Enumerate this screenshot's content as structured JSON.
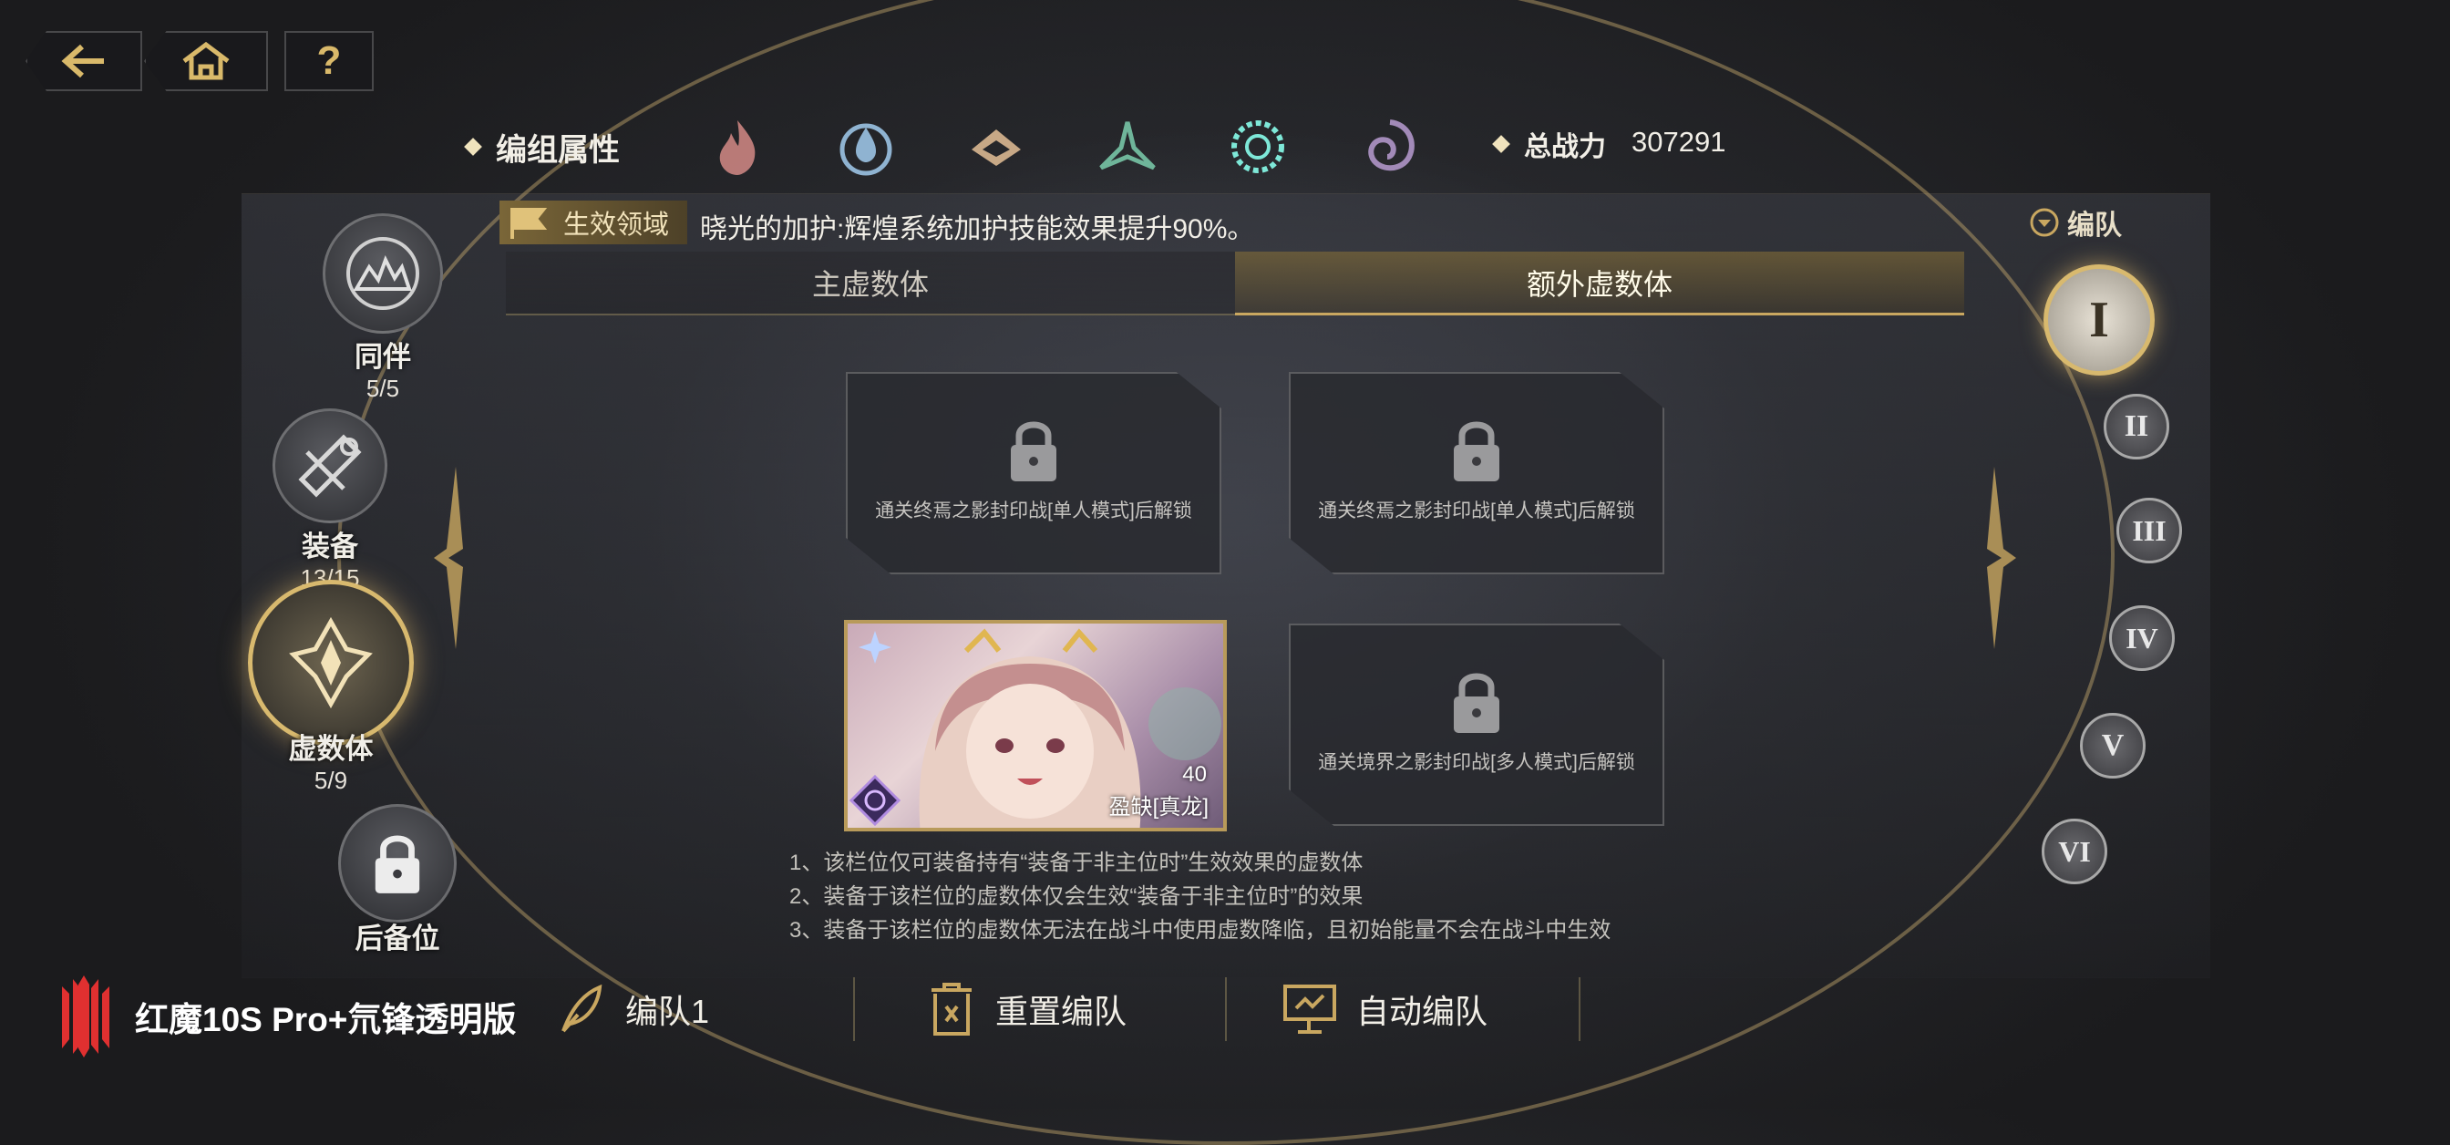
{
  "nav": {
    "back_icon": "back-arrow-icon",
    "home_icon": "home-icon",
    "help_label": "?"
  },
  "attributes": {
    "title": "编组属性",
    "elements": [
      "fire-icon",
      "water-icon",
      "earth-icon",
      "wind-icon",
      "light-icon",
      "dark-icon"
    ],
    "power_label": "总战力",
    "power_value": "307291"
  },
  "domain": {
    "label": "生效领域",
    "text": "晓光的加护:辉煌系统加护技能效果提升90%。"
  },
  "team_toggle": {
    "label": "编队"
  },
  "tabs": {
    "main": "主虚数体",
    "extra": "额外虚数体"
  },
  "slots": [
    {
      "locked": true,
      "text": "通关终焉之影封印战[单人模式]后解锁"
    },
    {
      "locked": true,
      "text": "通关终焉之影封印战[单人模式]后解锁"
    },
    {
      "locked": false,
      "character": {
        "name": "盈缺[真龙]",
        "level": "40"
      }
    },
    {
      "locked": true,
      "text": "通关境界之影封印战[多人模式]后解锁"
    }
  ],
  "sidebar": [
    {
      "label": "同伴",
      "count": "5/5"
    },
    {
      "label": "装备",
      "count": "13/15"
    },
    {
      "label": "虚数体",
      "count": "5/9"
    },
    {
      "label": "后备位",
      "count": ""
    }
  ],
  "teams": [
    "I",
    "II",
    "III",
    "IV",
    "V",
    "VI"
  ],
  "notes": [
    "1、该栏位仅可装备持有“装备于非主位时”生效效果的虚数体",
    "2、装备于该栏位的虚数体仅会生效“装备于非主位时”的效果",
    "3、装备于该栏位的虚数体无法在战斗中使用虚数降临，且初始能量不会在战斗中生效"
  ],
  "bottom": {
    "team_name": "编队1",
    "reset": "重置编队",
    "auto": "自动编队"
  },
  "brand": {
    "text": "红魔10S Pro+氘锋透明版"
  },
  "colors": {
    "gold": "#c9a760",
    "accent_red": "#e03030"
  }
}
